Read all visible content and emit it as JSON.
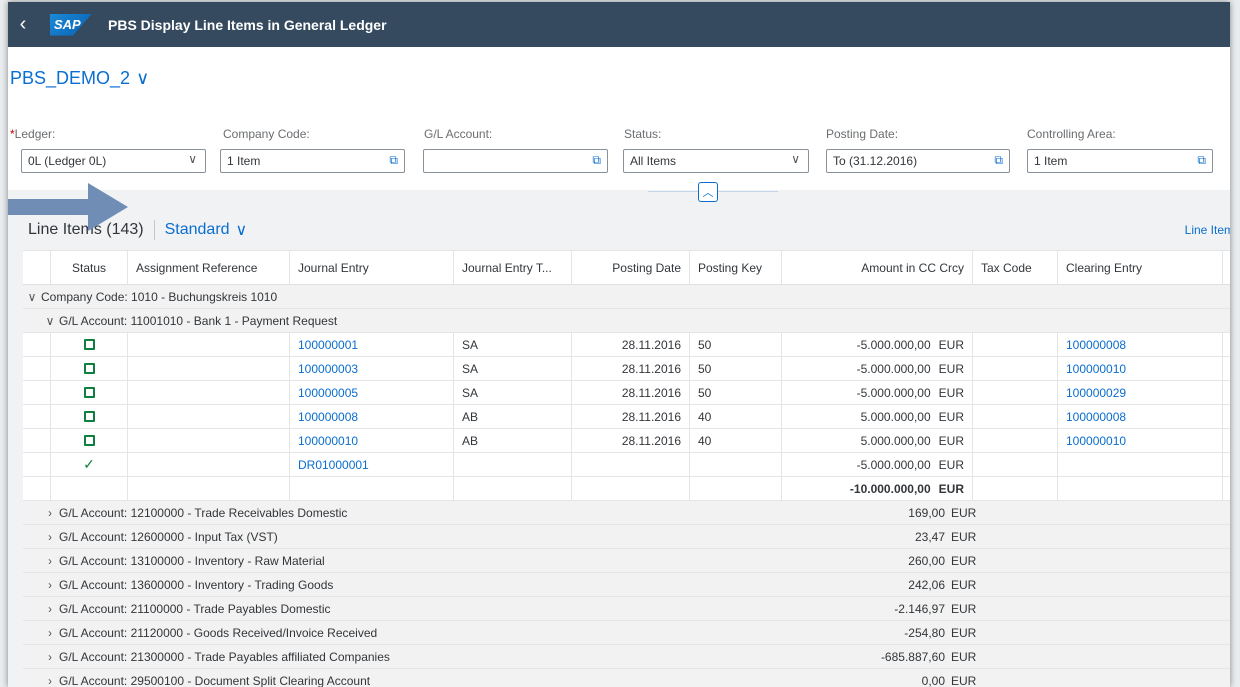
{
  "shell": {
    "title": "PBS Display Line Items in General Ledger",
    "logo": "SAP"
  },
  "variant": {
    "name": "PBS_DEMO_2"
  },
  "filters": {
    "ledger": {
      "label": "Ledger:",
      "value": "0L (Ledger 0L)"
    },
    "company_code": {
      "label": "Company Code:",
      "value": "1 Item"
    },
    "gl_account": {
      "label": "G/L Account:",
      "value": ""
    },
    "status": {
      "label": "Status:",
      "value": "All Items"
    },
    "posting_date": {
      "label": "Posting Date:",
      "value": "To (31.12.2016)"
    },
    "controlling_area": {
      "label": "Controlling Area:",
      "value": "1 Item"
    }
  },
  "toolbar": {
    "count": "Line Items (143)",
    "view": "Standard",
    "right_link": "Line Item"
  },
  "columns": [
    "Status",
    "Assignment Reference",
    "Journal Entry",
    "Journal Entry T...",
    "Posting Date",
    "Posting Key",
    "Amount in CC Crcy",
    "Tax Code",
    "Clearing Entry"
  ],
  "groups": {
    "company": "Company Code: 1010 - Buchungskreis 1010",
    "account1": "G/L Account: 11001010 - Bank 1 - Payment Request"
  },
  "rows": [
    {
      "status": "open",
      "je": "100000001",
      "jet": "SA",
      "date": "28.11.2016",
      "pk": "50",
      "amt": "-5.000.000,00",
      "cur": "EUR",
      "clr": "100000008"
    },
    {
      "status": "open",
      "je": "100000003",
      "jet": "SA",
      "date": "28.11.2016",
      "pk": "50",
      "amt": "-5.000.000,00",
      "cur": "EUR",
      "clr": "100000010"
    },
    {
      "status": "open",
      "je": "100000005",
      "jet": "SA",
      "date": "28.11.2016",
      "pk": "50",
      "amt": "-5.000.000,00",
      "cur": "EUR",
      "clr": "100000029"
    },
    {
      "status": "open",
      "je": "100000008",
      "jet": "AB",
      "date": "28.11.2016",
      "pk": "40",
      "amt": "5.000.000,00",
      "cur": "EUR",
      "clr": "100000008"
    },
    {
      "status": "open",
      "je": "100000010",
      "jet": "AB",
      "date": "28.11.2016",
      "pk": "40",
      "amt": "5.000.000,00",
      "cur": "EUR",
      "clr": "100000010"
    },
    {
      "status": "cleared",
      "je": "DR01000001",
      "jet": "",
      "date": "",
      "pk": "",
      "amt": "-5.000.000,00",
      "cur": "EUR",
      "clr": ""
    }
  ],
  "subtotal": {
    "amt": "-10.000.000,00",
    "cur": "EUR"
  },
  "collapsed_groups": [
    {
      "label": "G/L Account: 12100000 - Trade Receivables Domestic",
      "amt": "169,00",
      "cur": "EUR"
    },
    {
      "label": "G/L Account: 12600000 - Input Tax (VST)",
      "amt": "23,47",
      "cur": "EUR"
    },
    {
      "label": "G/L Account: 13100000 - Inventory - Raw Material",
      "amt": "260,00",
      "cur": "EUR"
    },
    {
      "label": "G/L Account: 13600000 - Inventory - Trading Goods",
      "amt": "242,06",
      "cur": "EUR"
    },
    {
      "label": "G/L Account: 21100000 - Trade Payables Domestic",
      "amt": "-2.146,97",
      "cur": "EUR"
    },
    {
      "label": "G/L Account: 21120000 - Goods Received/Invoice Received",
      "amt": "-254,80",
      "cur": "EUR"
    },
    {
      "label": "G/L Account: 21300000 - Trade Payables affiliated Companies",
      "amt": "-685.887,60",
      "cur": "EUR"
    },
    {
      "label": "G/L Account: 29500100 - Document Split Clearing Account",
      "amt": "0,00",
      "cur": "EUR"
    }
  ]
}
